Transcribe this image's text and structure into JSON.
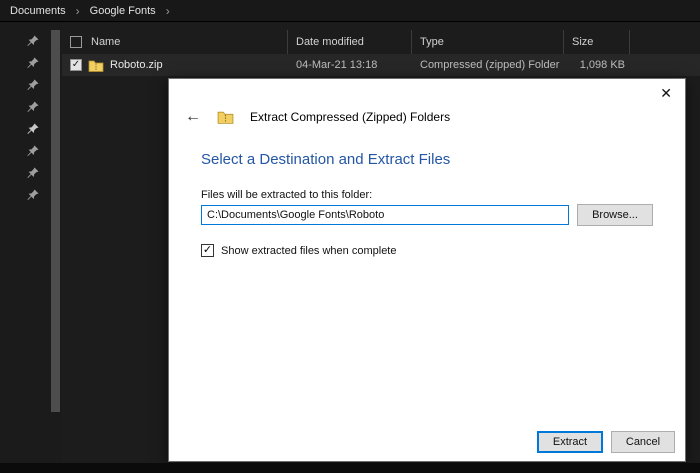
{
  "explorer": {
    "breadcrumb": [
      "Documents",
      "Google Fonts"
    ],
    "columns": [
      "Name",
      "Date modified",
      "Type",
      "Size"
    ],
    "files": [
      {
        "name": "Roboto.zip",
        "modified": "04-Mar-21 13:18",
        "type": "Compressed (zipped) Folder",
        "size": "1,098 KB",
        "checked": "true"
      }
    ]
  },
  "dialog": {
    "title": "Extract Compressed (Zipped) Folders",
    "heading": "Select a Destination and Extract Files",
    "destination_label": "Files will be extracted to this folder:",
    "path_value": "C:\\Documents\\Google Fonts\\Roboto",
    "browse_label": "Browse...",
    "checkbox_label": "Show extracted files when complete",
    "checkbox_checked": "true",
    "extract_label": "Extract",
    "cancel_label": "Cancel"
  },
  "icons": {
    "check": "✓",
    "close": "✕",
    "back": "←",
    "chevron": "›"
  },
  "colors": {
    "accent_blue": "#0078d7",
    "heading_blue": "#2456a4",
    "folder_yellow": "#f2cf60",
    "explorer_bg": "#1c1c1c",
    "dialog_bg": "#ffffff"
  }
}
